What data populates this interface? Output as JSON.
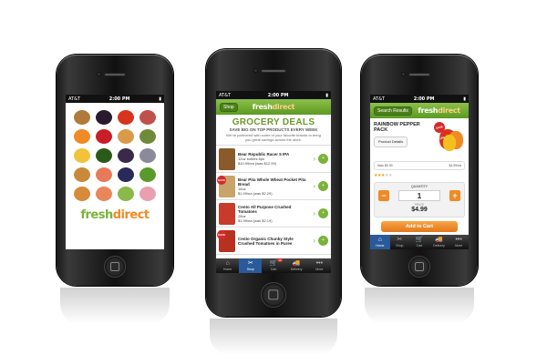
{
  "status": {
    "carrier": "AT&T",
    "time": "2:00 PM"
  },
  "brand": {
    "fresh": "fresh",
    "direct": "direct"
  },
  "phone1": {
    "grid_icons": [
      {
        "name": "mushrooms-icon",
        "color": "#b07a3a"
      },
      {
        "name": "eggplant-icon",
        "color": "#2a1a2e"
      },
      {
        "name": "pepper-icon",
        "color": "#d8331c"
      },
      {
        "name": "meat-icon",
        "color": "#c0504a"
      },
      {
        "name": "carrot-icon",
        "color": "#f08a24"
      },
      {
        "name": "strawberry-icon",
        "color": "#c81e2a"
      },
      {
        "name": "pastry-icon",
        "color": "#d99a4a"
      },
      {
        "name": "artichoke-icon",
        "color": "#6e8a3a"
      },
      {
        "name": "corn-icon",
        "color": "#f2c23a"
      },
      {
        "name": "avocado-icon",
        "color": "#2a5a1a"
      },
      {
        "name": "grapes-icon",
        "color": "#3a2a4a"
      },
      {
        "name": "fish-icon",
        "color": "#8a8a9a"
      },
      {
        "name": "bread-icon",
        "color": "#c88a3a"
      },
      {
        "name": "salmon-icon",
        "color": "#e87a5a"
      },
      {
        "name": "berries-icon",
        "color": "#2a2a5a"
      },
      {
        "name": "salad-icon",
        "color": "#5a9a2a"
      },
      {
        "name": "pie-icon",
        "color": "#d68a3a"
      },
      {
        "name": "shrimp-icon",
        "color": "#e9865a"
      },
      {
        "name": "celery-icon",
        "color": "#8ab84a"
      },
      {
        "name": "cupcake-icon",
        "color": "#e8a0b0"
      }
    ]
  },
  "phone2": {
    "nav": {
      "back_label": "Shop"
    },
    "title": "GROCERY DEALS",
    "subtitle": "SAVE BIG ON TOP PRODUCTS EVERY WEEK",
    "description": "We've partnered with some of your favorite brands to bring you great savings across the store.",
    "products": [
      {
        "name": "Bear Republic Racer 5 IPA",
        "detail": "12oz bottles 6pk",
        "price": "$10.99/ea (was $12.99)",
        "sale": false,
        "thumb": "#8a5a2a"
      },
      {
        "name": "Bear Pita Whole Wheat Pocket Pita Bread",
        "detail": "16oz",
        "price": "$1.99/ea (was $2.29)",
        "sale": true,
        "thumb": "#c8a46a"
      },
      {
        "name": "Cento All Purpose Crushed Tomatoes",
        "detail": "28oz",
        "price": "$1.99/ea (was $2.19)",
        "sale": false,
        "thumb": "#c83a2a"
      },
      {
        "name": "Cento Organic Chunky Style Crushed Tomatoes in Puree",
        "detail": "",
        "price": "",
        "sale": true,
        "thumb": "#b83020"
      }
    ],
    "tabs": [
      {
        "label": "Home",
        "icon": "⌂",
        "name": "home-icon",
        "active": false
      },
      {
        "label": "Shop",
        "icon": "✂",
        "name": "shop-icon",
        "active": true
      },
      {
        "label": "Cart",
        "icon": "🛒",
        "name": "cart-icon",
        "active": false,
        "badge": "10"
      },
      {
        "label": "Delivery",
        "icon": "🚚",
        "name": "delivery-icon",
        "active": false
      },
      {
        "label": "More",
        "icon": "•••",
        "name": "more-icon",
        "active": false
      }
    ],
    "sale_badge": "SAVE"
  },
  "phone3": {
    "nav": {
      "back_label": "Search Results"
    },
    "product_title": "RAINBOW PEPPER PACK",
    "details_button": "Product Details",
    "sale_tag": "SAVE 15%",
    "price_left": "Was $5.99",
    "price_right": "$4.99/ea",
    "rating": 3,
    "quantity_label": "QUANTITY",
    "quantity": "1",
    "price_label": "PRICE",
    "price": "$4.99",
    "add_to_cart": "Add to Cart",
    "tabs": [
      {
        "label": "Home",
        "icon": "⌂",
        "name": "home-icon",
        "active": true
      },
      {
        "label": "Shop",
        "icon": "✂",
        "name": "shop-icon",
        "active": false
      },
      {
        "label": "Cart",
        "icon": "🛒",
        "name": "cart-icon",
        "active": false
      },
      {
        "label": "Delivery",
        "icon": "🚚",
        "name": "delivery-icon",
        "active": false
      },
      {
        "label": "More",
        "icon": "•••",
        "name": "more-icon",
        "active": false
      }
    ]
  }
}
